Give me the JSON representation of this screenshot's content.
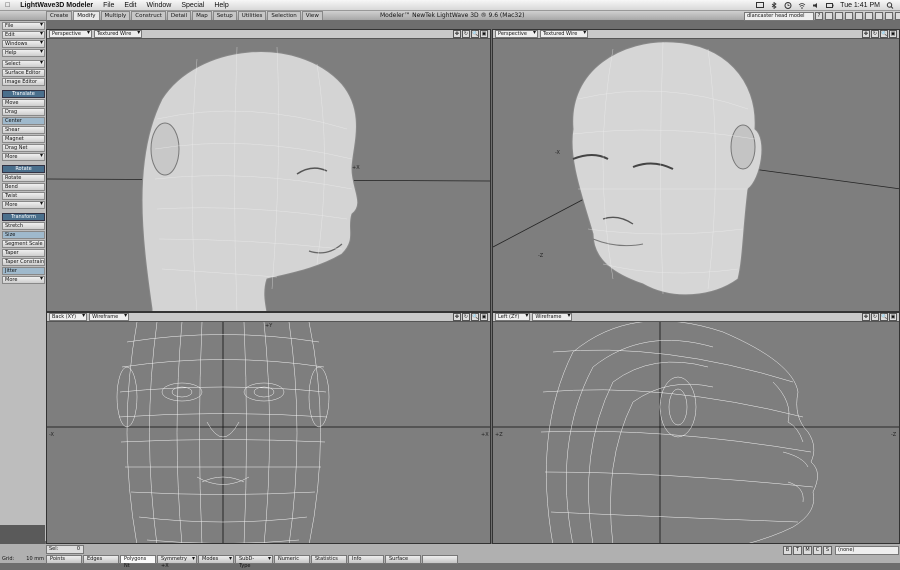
{
  "menubar": {
    "apple": "",
    "app_name": "LightWave3D Modeler",
    "items": [
      "File",
      "Edit",
      "Window",
      "Special",
      "Help"
    ],
    "clock": "Tue 1:41 PM"
  },
  "window": {
    "title": "Modeler™ NewTek LightWave 3D ® 9.6  (Mac32)",
    "model_select": "dlancaster head model"
  },
  "tabs": [
    "Create",
    "Modify",
    "Multiply",
    "Construct",
    "Detail",
    "Map",
    "Setup",
    "Utilities",
    "Selection",
    "View"
  ],
  "active_tab": "Modify",
  "toolbar": {
    "top": [
      "File",
      "Edit",
      "Windows",
      "Help"
    ],
    "select": "Select",
    "editors": [
      "Surface Editor",
      "Image Editor"
    ],
    "translate_head": "Translate",
    "translate": [
      "Move",
      "Drag",
      "Center",
      "Shear",
      "Magnet",
      "Drag Net",
      "More"
    ],
    "rotate_head": "Rotate",
    "rotate": [
      "Rotate",
      "Bend",
      "Twist",
      "More"
    ],
    "transform_head": "Transform",
    "transform": [
      "Stretch",
      "Size",
      "Segment Scale",
      "Taper",
      "Taper Constrain",
      "Jitter",
      "More"
    ]
  },
  "viewports": [
    {
      "view": "Perspective",
      "mode": "Textured Wire"
    },
    {
      "view": "Perspective",
      "mode": "Textured Wire"
    },
    {
      "view": "Back  (XY)",
      "mode": "Wireframe"
    },
    {
      "view": "Left  (ZY)",
      "mode": "Wireframe"
    }
  ],
  "axis_labels": {
    "tl_x": "+X",
    "tr_x": "-X",
    "tr_z": "-Z",
    "back_y": "+Y",
    "back_left": "-X",
    "back_right": "+X",
    "left_left": "+Z",
    "left_right": "-Z"
  },
  "bottom": {
    "sel_label": "Sel:",
    "sel_value": "0",
    "grid_label": "Grid:",
    "grid_value": "10 mm",
    "buttons": [
      "Points",
      "Edges",
      "Polygons",
      "Symmetry",
      "Modes",
      "SubD-Type",
      "Numeric",
      "Statistics",
      "Info",
      "Surface",
      ""
    ],
    "symmetry_state": "+X",
    "polygons_state": "Nt",
    "mode_buttons": [
      "B",
      "T",
      "M",
      "C",
      "S"
    ],
    "mode_select": "(none)"
  }
}
